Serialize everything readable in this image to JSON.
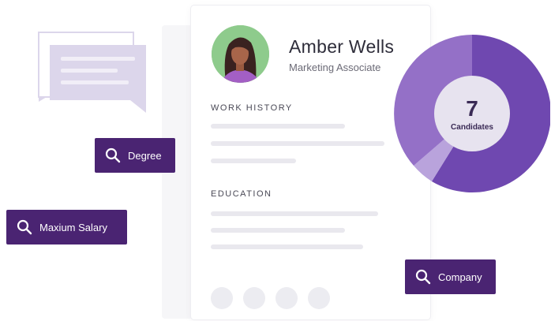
{
  "profile": {
    "name": "Amber Wells",
    "title": "Marketing Associate"
  },
  "sections": {
    "work_history": "WORK HISTORY",
    "education": "EDUCATION"
  },
  "filters": {
    "degree": "Degree",
    "max_salary": "Maxium Salary",
    "company": "Company"
  },
  "candidates": {
    "count": "7",
    "label": "Candidates"
  },
  "colors": {
    "brand": "#4a2472",
    "donut_dark": "#6f48b0",
    "donut_mid": "#9470c7",
    "donut_light": "#b9a3dc",
    "bubble": "#dcd6eb"
  }
}
